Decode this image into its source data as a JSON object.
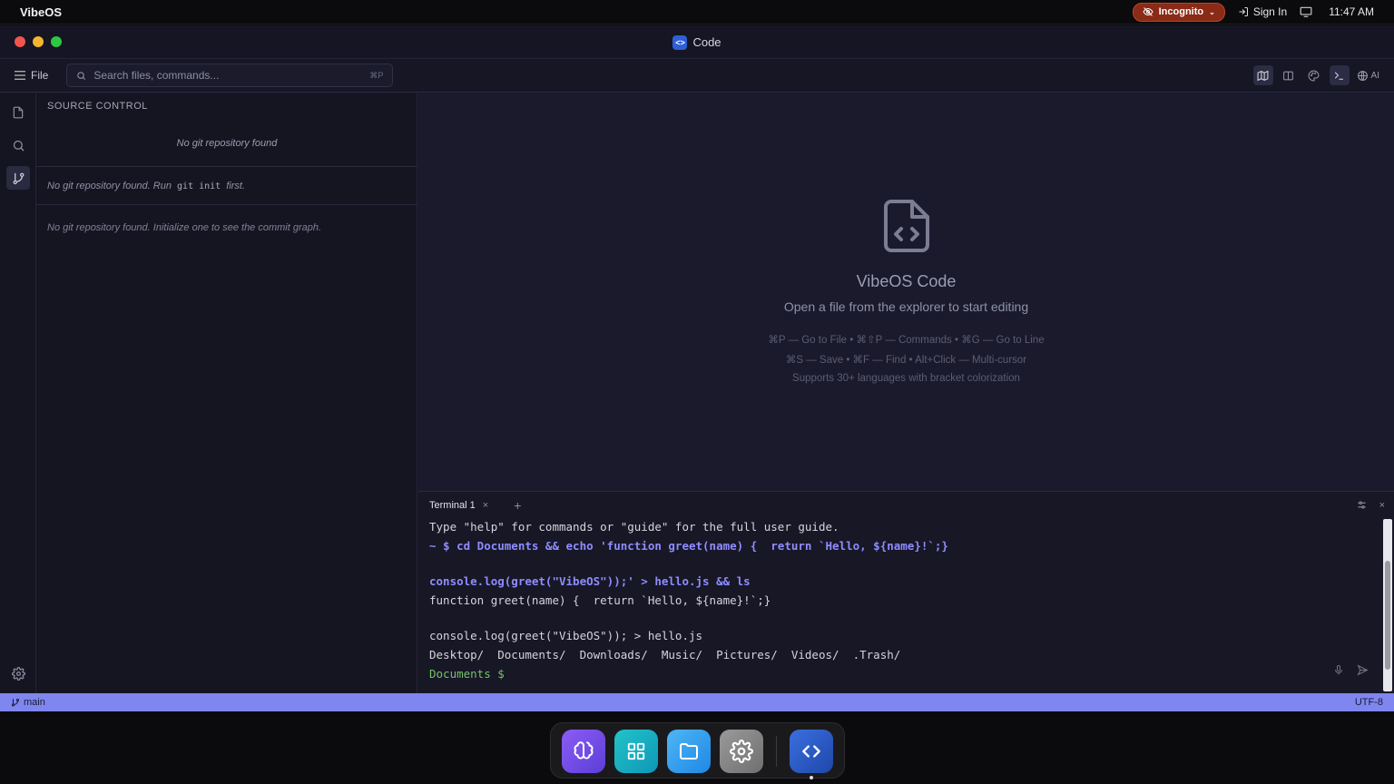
{
  "menubar": {
    "brand": "VibeOS",
    "incognito_label": "Incognito",
    "signin_label": "Sign In",
    "time": "11:47 AM"
  },
  "window": {
    "title": "Code"
  },
  "toolbar": {
    "file_label": "File",
    "search_placeholder": "Search files, commands...",
    "search_shortcut": "⌘P",
    "ai_label": "AI"
  },
  "sidebar": {
    "title": "SOURCE CONTROL",
    "msg_no_repo": "No git repository found",
    "msg_run_prefix": "No git repository found. Run",
    "msg_run_code": "git init",
    "msg_run_suffix": "first.",
    "msg_graph": "No git repository found. Initialize one to see the commit graph."
  },
  "editor": {
    "welcome_title": "VibeOS Code",
    "welcome_subtitle": "Open a file from the explorer to start editing",
    "hint1": "⌘P — Go to File • ⌘⇧P — Commands • ⌘G — Go to Line",
    "hint2": "⌘S — Save • ⌘F — Find • Alt+Click — Multi-cursor",
    "hint3": "Supports 30+ languages with bracket colorization"
  },
  "terminal": {
    "tab_label": "Terminal 1",
    "lines": [
      "Type \"help\" for commands or \"guide\" for the full user guide.",
      "~ $ cd Documents && echo 'function greet(name) {  return `Hello, ${name}!`;}",
      "",
      "console.log(greet(\"VibeOS\"));' > hello.js && ls",
      "function greet(name) {  return `Hello, ${name}!`;}",
      "",
      "console.log(greet(\"VibeOS\")); > hello.js",
      "Desktop/  Documents/  Downloads/  Music/  Pictures/  Videos/  .Trash/",
      "Documents $"
    ]
  },
  "statusbar": {
    "branch": "main",
    "encoding": "UTF-8"
  },
  "colors": {
    "accent": "#7f86f0",
    "incognito": "#8a2a17",
    "prompt": "#78c26a",
    "command": "#8f8cff"
  }
}
